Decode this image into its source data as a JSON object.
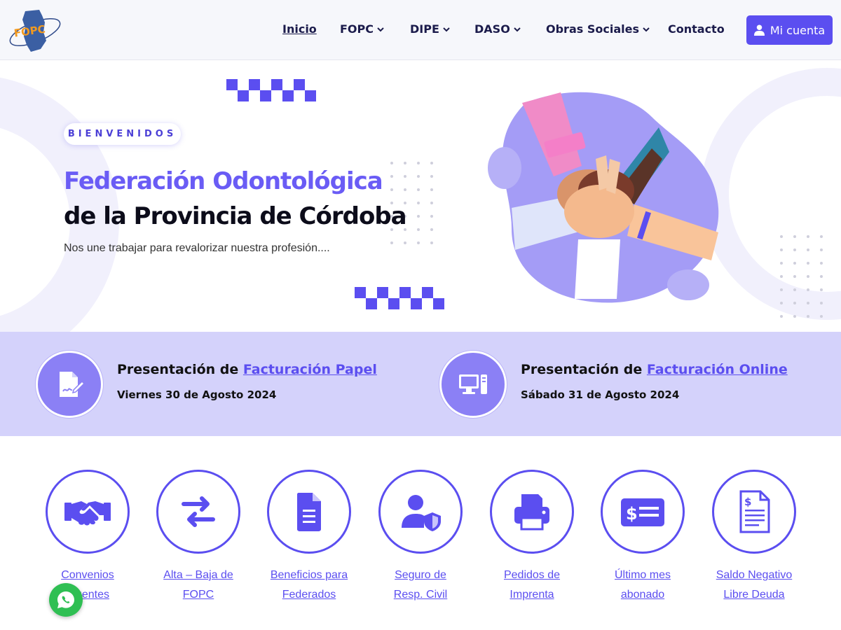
{
  "header": {
    "logo_text": "FOPC",
    "nav": [
      {
        "label": "Inicio",
        "has_dropdown": false,
        "active": true
      },
      {
        "label": "FOPC",
        "has_dropdown": true
      },
      {
        "label": "DIPE",
        "has_dropdown": true
      },
      {
        "label": "DASO",
        "has_dropdown": true
      },
      {
        "label": "Obras Sociales",
        "has_dropdown": true
      },
      {
        "label": "Contacto",
        "has_dropdown": false
      }
    ],
    "account_button": {
      "label": "Mi cuenta",
      "icon": "user-icon"
    }
  },
  "hero": {
    "badge": "BIENVENIDOS",
    "title_line1": "Federación Odontológica",
    "title_line2": "de la Provincia de Córdoba",
    "subtitle": "Nos une trabajar para revalorizar nuestra profesión....",
    "illustration": "stacked-hands-illustration"
  },
  "announcements": [
    {
      "prefix": "Presentación de ",
      "link": "Facturación Papel",
      "date": "Viernes 30 de Agosto 2024",
      "icon": "signed-document-icon"
    },
    {
      "prefix": "Presentación de ",
      "link": "Facturación Online",
      "date": "Sábado 31 de Agosto 2024",
      "icon": "desktop-computer-icon"
    }
  ],
  "services": [
    {
      "line1": "Convenios",
      "line2": "Vigentes",
      "icon": "handshake-icon"
    },
    {
      "line1": "Alta – Baja de",
      "line2": "FOPC",
      "icon": "swap-arrows-icon"
    },
    {
      "line1": "Beneficios para",
      "line2": "Federados",
      "icon": "document-icon"
    },
    {
      "line1": "Seguro de",
      "line2": "Resp. Civil",
      "icon": "user-shield-icon"
    },
    {
      "line1": "Pedidos de",
      "line2": "Imprenta",
      "icon": "printer-icon"
    },
    {
      "line1": "Último mes",
      "line2": "abonado",
      "icon": "money-check-icon"
    },
    {
      "line1": "Saldo Negativo",
      "line2": "Libre Deuda",
      "icon": "invoice-icon"
    }
  ],
  "colors": {
    "accent": "#5b4ef0",
    "band": "#d4d2fb",
    "whatsapp": "#2fbf53",
    "logo_orange": "#f39a1f",
    "logo_navy": "#2f4a8a"
  }
}
